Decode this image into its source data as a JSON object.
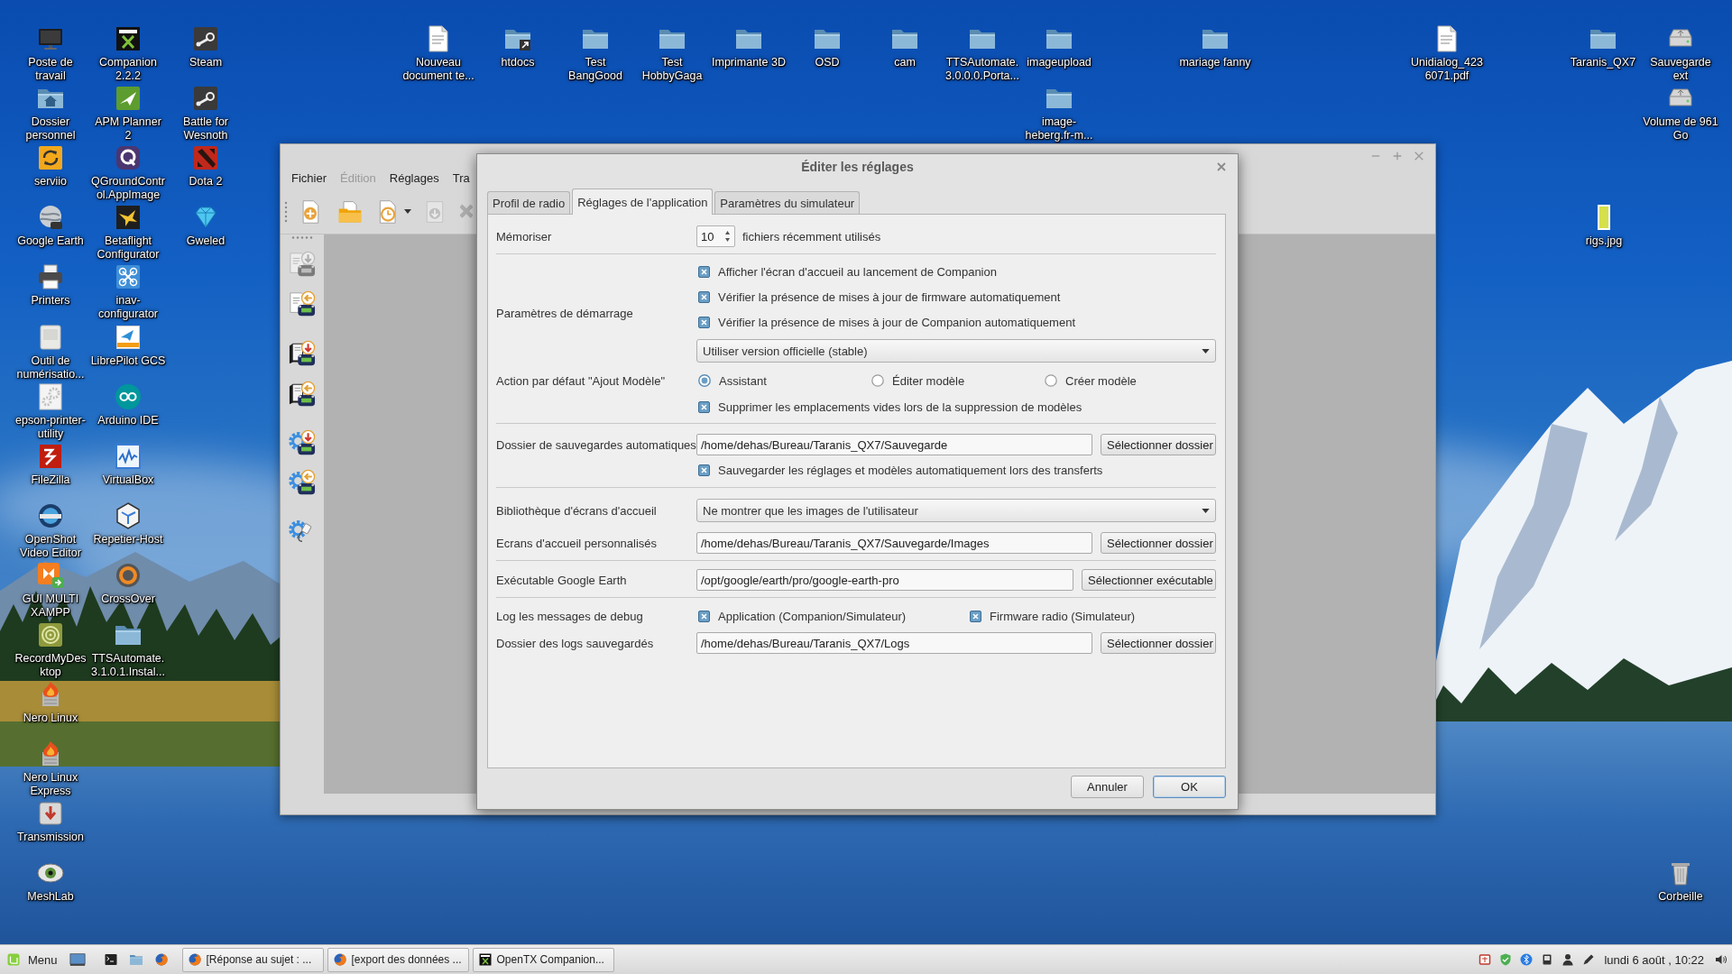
{
  "desktop": {
    "icons": [
      {
        "label": "Poste de travail"
      },
      {
        "label": "Dossier personnel"
      },
      {
        "label": "serviio"
      },
      {
        "label": "Google Earth"
      },
      {
        "label": "Printers"
      },
      {
        "label": "Outil de numérisatio..."
      },
      {
        "label": "epson-printer-utility"
      },
      {
        "label": "FileZilla"
      },
      {
        "label": "OpenShot Video Editor"
      },
      {
        "label": "GUI MULTI XAMPP"
      },
      {
        "label": "RecordMyDesktop"
      },
      {
        "label": "Nero Linux"
      },
      {
        "label": "Nero Linux Express"
      },
      {
        "label": "Transmission"
      },
      {
        "label": "MeshLab"
      },
      {
        "label": "Companion 2.2.2"
      },
      {
        "label": "APM Planner 2"
      },
      {
        "label": "QGroundControl.AppImage"
      },
      {
        "label": "Betaflight Configurator"
      },
      {
        "label": "inav-configurator"
      },
      {
        "label": "LibrePilot GCS"
      },
      {
        "label": "Arduino IDE"
      },
      {
        "label": "VirtualBox"
      },
      {
        "label": "Repetier-Host"
      },
      {
        "label": "CrossOver"
      },
      {
        "label": "TTSAutomate.3.1.0.1.Instal..."
      },
      {
        "label": "Steam"
      },
      {
        "label": "Battle for Wesnoth"
      },
      {
        "label": "Dota 2"
      },
      {
        "label": "Gweled"
      },
      {
        "label": "Nouveau document te..."
      },
      {
        "label": "htdocs"
      },
      {
        "label": "Test BangGood"
      },
      {
        "label": "Test HobbyGaga"
      },
      {
        "label": "Imprimante 3D"
      },
      {
        "label": "OSD"
      },
      {
        "label": "cam"
      },
      {
        "label": "TTSAutomate.3.0.0.0.Porta..."
      },
      {
        "label": "imageupload"
      },
      {
        "label": "image-heberg.fr-m..."
      },
      {
        "label": "mariage fanny"
      },
      {
        "label": "Unidialog_4236071.pdf"
      },
      {
        "label": "Taranis_QX7"
      },
      {
        "label": "Sauvegarde ext"
      },
      {
        "label": "Volume de 961 Go"
      },
      {
        "label": "rigs.jpg"
      },
      {
        "label": "Corbeille"
      }
    ]
  },
  "main_window": {
    "menu": [
      {
        "label": "Fichier",
        "disabled": false
      },
      {
        "label": "Édition",
        "disabled": true
      },
      {
        "label": "Réglages",
        "disabled": false
      },
      {
        "label": "Tra",
        "disabled": false
      }
    ],
    "toolbar": [
      {
        "disabled": false
      },
      {
        "disabled": false
      },
      {
        "disabled": false
      },
      {
        "disabled": true
      },
      {
        "disabled": true
      }
    ],
    "side_toolbar": [
      {
        "disabled": true
      },
      {
        "disabled": false
      },
      {
        "disabled": false
      },
      {
        "disabled": false
      },
      {
        "disabled": false
      },
      {
        "disabled": false
      },
      {
        "disabled": false
      }
    ]
  },
  "settings_dialog": {
    "title": "Éditer les réglages",
    "tabs": [
      {
        "label": "Profil de radio",
        "selected": false
      },
      {
        "label": "Réglages de l'application",
        "selected": true
      },
      {
        "label": "Paramètres du simulateur",
        "selected": false
      }
    ],
    "recent_files": {
      "label": "Mémoriser",
      "value": "10",
      "suffix": "fichiers récemment utilisés"
    },
    "startup": {
      "label": "Paramètres de démarrage",
      "options": [
        {
          "label": "Afficher l'écran d'accueil au lancement de Companion",
          "checked": true
        },
        {
          "label": "Vérifier la présence de mises à jour de firmware automatiquement",
          "checked": true
        },
        {
          "label": "Vérifier la présence de mises à jour de Companion automatiquement",
          "checked": true
        }
      ],
      "version_select": "Utiliser version officielle (stable)"
    },
    "default_action": {
      "label": "Action par défaut \"Ajout Modèle\"",
      "choices": [
        {
          "label": "Assistant",
          "selected": true
        },
        {
          "label": "Éditer modèle",
          "selected": false
        },
        {
          "label": "Créer modèle",
          "selected": false
        }
      ],
      "remove_empty_slots": {
        "label": "Supprimer les emplacements vides lors de la suppression de modèles",
        "checked": true
      }
    },
    "backup": {
      "label": "Dossier de sauvegardes automatiques",
      "path": "/home/dehas/Bureau/Taranis_QX7/Sauvegarde",
      "button": "Sélectionner dossier",
      "auto_save": {
        "label": "Sauvegarder les réglages et modèles automatiquement lors des transferts",
        "checked": true
      }
    },
    "splash_library": {
      "label": "Bibliothèque d'écrans d'accueil",
      "value": "Ne montrer que les images de l'utilisateur"
    },
    "custom_splash": {
      "label": "Ecrans d'accueil personnalisés",
      "path": "/home/dehas/Bureau/Taranis_QX7/Sauvegarde/Images",
      "button": "Sélectionner dossier"
    },
    "google_earth": {
      "label": "Exécutable Google Earth",
      "path": "/opt/google/earth/pro/google-earth-pro",
      "button": "Sélectionner exécutable"
    },
    "debug_log": {
      "label": "Log les messages de debug",
      "options": [
        {
          "label": "Application (Companion/Simulateur)",
          "checked": true
        },
        {
          "label": "Firmware radio (Simulateur)",
          "checked": true
        }
      ]
    },
    "log_folder": {
      "label": "Dossier des logs sauvegardés",
      "path": "/home/dehas/Bureau/Taranis_QX7/Logs",
      "button": "Sélectionner dossier"
    },
    "buttons": [
      {
        "label": "Annuler",
        "default": false
      },
      {
        "label": "OK",
        "default": true
      }
    ]
  },
  "taskbar": {
    "menu_label": "Menu",
    "windows": [
      {
        "title": "[Réponse au sujet : ..."
      },
      {
        "title": "[export des données ..."
      },
      {
        "title": "OpenTX Companion..."
      }
    ],
    "clock": "lundi 6 août , 10:22"
  }
}
